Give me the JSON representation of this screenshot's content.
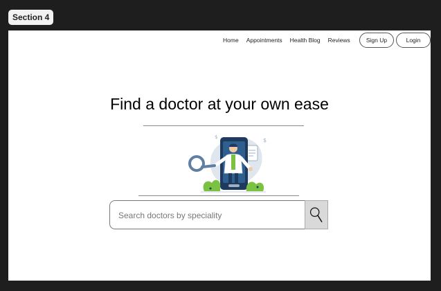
{
  "section_tag": "Section 4",
  "nav": {
    "items": [
      "Home",
      "Appointments",
      "Health Blog",
      "Reviews"
    ],
    "signup_label": "Sign Up",
    "login_label": "Login"
  },
  "hero": {
    "title": "Find a doctor at your own ease"
  },
  "search": {
    "placeholder": "Search doctors by speciality",
    "value": "",
    "button_icon": "search-icon"
  },
  "colors": {
    "frame_bg": "#ffffff",
    "canvas_bg": "#1e1e1e",
    "search_button_bg": "#d9d9d9",
    "illustration_accent": "#7cc242",
    "illustration_blue": "#1e3a5f"
  }
}
